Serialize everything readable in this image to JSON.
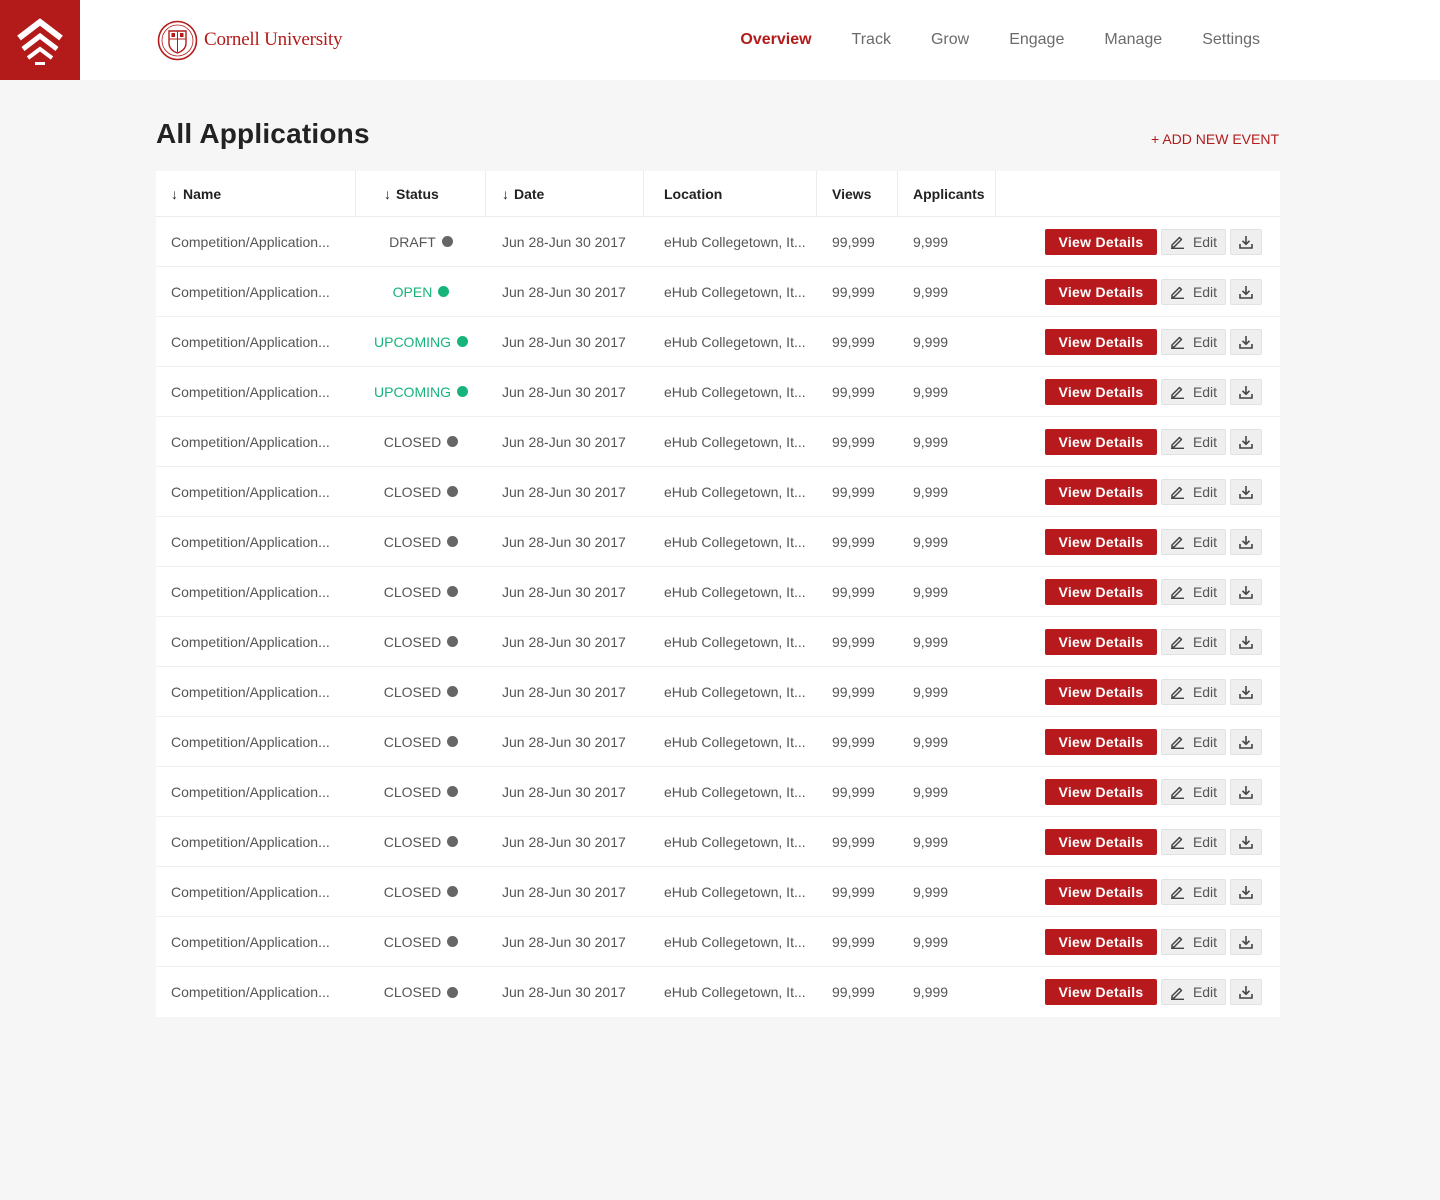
{
  "brand": {
    "name": "Cornell University"
  },
  "nav": [
    {
      "label": "Overview",
      "active": true
    },
    {
      "label": "Track",
      "active": false
    },
    {
      "label": "Grow",
      "active": false
    },
    {
      "label": "Engage",
      "active": false
    },
    {
      "label": "Manage",
      "active": false
    },
    {
      "label": "Settings",
      "active": false
    }
  ],
  "page": {
    "title": "All Applications",
    "add_event_label": "+ ADD NEW EVENT"
  },
  "table": {
    "columns": {
      "name": "Name",
      "status": "Status",
      "date": "Date",
      "location": "Location",
      "views": "Views",
      "applicants": "Applicants"
    },
    "actions": {
      "view_label": "View Details",
      "edit_label": "Edit"
    },
    "status_colors": {
      "draft": "#666666",
      "open": "#16b47a",
      "upcoming": "#16b47a",
      "closed": "#666666"
    },
    "rows": [
      {
        "name": "Competition/Application...",
        "status": "DRAFT",
        "status_key": "draft",
        "date": "Jun 28-Jun 30 2017",
        "location": "eHub Collegetown, It...",
        "views": "99,999",
        "applicants": "9,999"
      },
      {
        "name": "Competition/Application...",
        "status": "OPEN",
        "status_key": "open",
        "date": "Jun 28-Jun 30 2017",
        "location": "eHub Collegetown, It...",
        "views": "99,999",
        "applicants": "9,999"
      },
      {
        "name": "Competition/Application...",
        "status": "UPCOMING",
        "status_key": "upcoming",
        "date": "Jun 28-Jun 30 2017",
        "location": "eHub Collegetown, It...",
        "views": "99,999",
        "applicants": "9,999"
      },
      {
        "name": "Competition/Application...",
        "status": "UPCOMING",
        "status_key": "upcoming",
        "date": "Jun 28-Jun 30 2017",
        "location": "eHub Collegetown, It...",
        "views": "99,999",
        "applicants": "9,999"
      },
      {
        "name": "Competition/Application...",
        "status": "CLOSED",
        "status_key": "closed",
        "date": "Jun 28-Jun 30 2017",
        "location": "eHub Collegetown, It...",
        "views": "99,999",
        "applicants": "9,999"
      },
      {
        "name": "Competition/Application...",
        "status": "CLOSED",
        "status_key": "closed",
        "date": "Jun 28-Jun 30 2017",
        "location": "eHub Collegetown, It...",
        "views": "99,999",
        "applicants": "9,999"
      },
      {
        "name": "Competition/Application...",
        "status": "CLOSED",
        "status_key": "closed",
        "date": "Jun 28-Jun 30 2017",
        "location": "eHub Collegetown, It...",
        "views": "99,999",
        "applicants": "9,999"
      },
      {
        "name": "Competition/Application...",
        "status": "CLOSED",
        "status_key": "closed",
        "date": "Jun 28-Jun 30 2017",
        "location": "eHub Collegetown, It...",
        "views": "99,999",
        "applicants": "9,999"
      },
      {
        "name": "Competition/Application...",
        "status": "CLOSED",
        "status_key": "closed",
        "date": "Jun 28-Jun 30 2017",
        "location": "eHub Collegetown, It...",
        "views": "99,999",
        "applicants": "9,999"
      },
      {
        "name": "Competition/Application...",
        "status": "CLOSED",
        "status_key": "closed",
        "date": "Jun 28-Jun 30 2017",
        "location": "eHub Collegetown, It...",
        "views": "99,999",
        "applicants": "9,999"
      },
      {
        "name": "Competition/Application...",
        "status": "CLOSED",
        "status_key": "closed",
        "date": "Jun 28-Jun 30 2017",
        "location": "eHub Collegetown, It...",
        "views": "99,999",
        "applicants": "9,999"
      },
      {
        "name": "Competition/Application...",
        "status": "CLOSED",
        "status_key": "closed",
        "date": "Jun 28-Jun 30 2017",
        "location": "eHub Collegetown, It...",
        "views": "99,999",
        "applicants": "9,999"
      },
      {
        "name": "Competition/Application...",
        "status": "CLOSED",
        "status_key": "closed",
        "date": "Jun 28-Jun 30 2017",
        "location": "eHub Collegetown, It...",
        "views": "99,999",
        "applicants": "9,999"
      },
      {
        "name": "Competition/Application...",
        "status": "CLOSED",
        "status_key": "closed",
        "date": "Jun 28-Jun 30 2017",
        "location": "eHub Collegetown, It...",
        "views": "99,999",
        "applicants": "9,999"
      },
      {
        "name": "Competition/Application...",
        "status": "CLOSED",
        "status_key": "closed",
        "date": "Jun 28-Jun 30 2017",
        "location": "eHub Collegetown, It...",
        "views": "99,999",
        "applicants": "9,999"
      },
      {
        "name": "Competition/Application...",
        "status": "CLOSED",
        "status_key": "closed",
        "date": "Jun 28-Jun 30 2017",
        "location": "eHub Collegetown, It...",
        "views": "99,999",
        "applicants": "9,999"
      }
    ]
  },
  "colors": {
    "brand_red": "#b31b1b",
    "button_red": "#b8191c",
    "success_green": "#16b47a"
  },
  "icons": {
    "app": "chevrons-up-icon",
    "seal": "cornell-seal-icon",
    "sort": "arrow-down-icon",
    "edit": "pencil-icon",
    "download": "download-icon"
  }
}
